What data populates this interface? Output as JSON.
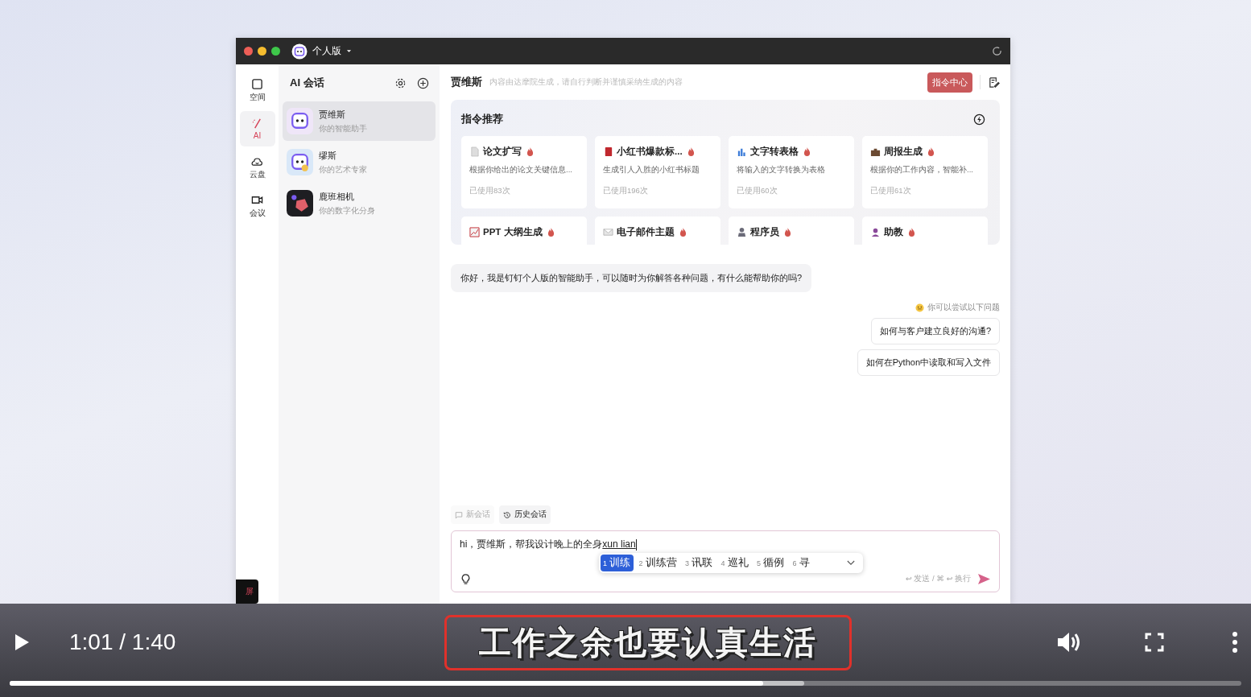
{
  "app": {
    "titlebar": {
      "edition": "个人版"
    },
    "nav": [
      {
        "kind": "space",
        "label": "空间",
        "selected": false
      },
      {
        "kind": "ai",
        "label": "AI",
        "selected": true
      },
      {
        "kind": "cloud",
        "label": "云盘",
        "selected": false
      },
      {
        "kind": "meeting",
        "label": "会议",
        "selected": false
      }
    ],
    "conversations": {
      "title": "AI 会话",
      "items": [
        {
          "kind": "robot",
          "name": "贾维斯",
          "subtitle": "你的智能助手",
          "selected": true
        },
        {
          "kind": "artist",
          "name": "缪斯",
          "subtitle": "你的艺术专家",
          "selected": false
        },
        {
          "kind": "cube",
          "name": "鹿班相机",
          "subtitle": "你的数字化分身",
          "selected": false
        }
      ]
    },
    "header": {
      "title": "贾维斯",
      "notice": "内容由达摩院生成，请自行判断并谨慎采纳生成的内容",
      "button": "指令中心"
    },
    "recommendations": {
      "title": "指令推荐",
      "cards": [
        {
          "kind": "doc",
          "title": "论文扩写",
          "description": "根据你给出的论文关键信息...",
          "usage": "已使用83次"
        },
        {
          "kind": "book",
          "title": "小红书爆款标...",
          "description": "生成引人入胜的小红书标题",
          "usage": "已使用196次"
        },
        {
          "kind": "bars",
          "title": "文字转表格",
          "description": "将输入的文字转换为表格",
          "usage": "已使用60次"
        },
        {
          "kind": "briefcase",
          "title": "周报生成",
          "description": "根据你的工作内容，智能补...",
          "usage": "已使用61次"
        },
        {
          "kind": "trend",
          "title": "PPT 大纲生成"
        },
        {
          "kind": "mail",
          "title": "电子邮件主题"
        },
        {
          "kind": "coder",
          "title": "程序员"
        },
        {
          "kind": "teacher",
          "title": "助教"
        }
      ]
    },
    "greeting": "你好，我是钉钉个人版的智能助手，可以随时为你解答各种问题，有什么能帮助你的吗?",
    "suggestions": {
      "hint": "你可以尝试以下问题",
      "items": [
        "如何与客户建立良好的沟通?",
        "如何在Python中读取和写入文件"
      ]
    },
    "session_tabs": [
      {
        "kind": "new",
        "label": "新会话",
        "disabled": true
      },
      {
        "kind": "history",
        "label": "历史会话",
        "disabled": false
      }
    ],
    "input": {
      "value": "hi，贾维斯，帮我设计晚上的全身",
      "composing": "xun lian",
      "shortcut_hint": "↩ 发送 / ⌘ ↩ 换行"
    },
    "ime_candidates": [
      {
        "index": "1",
        "text": "训练",
        "selected": true
      },
      {
        "index": "2",
        "text": "训练营",
        "selected": false
      },
      {
        "index": "3",
        "text": "讯联",
        "selected": false
      },
      {
        "index": "4",
        "text": "巡礼",
        "selected": false
      },
      {
        "index": "5",
        "text": "循例",
        "selected": false
      },
      {
        "index": "6",
        "text": "寻",
        "selected": false
      }
    ],
    "corner_badge": "屏"
  },
  "player": {
    "time": "1:01 / 1:40",
    "subtitle": "工作之余也要认真生活",
    "progress": {
      "level": 0.612
    },
    "buffered": {
      "level": 0.645
    }
  }
}
